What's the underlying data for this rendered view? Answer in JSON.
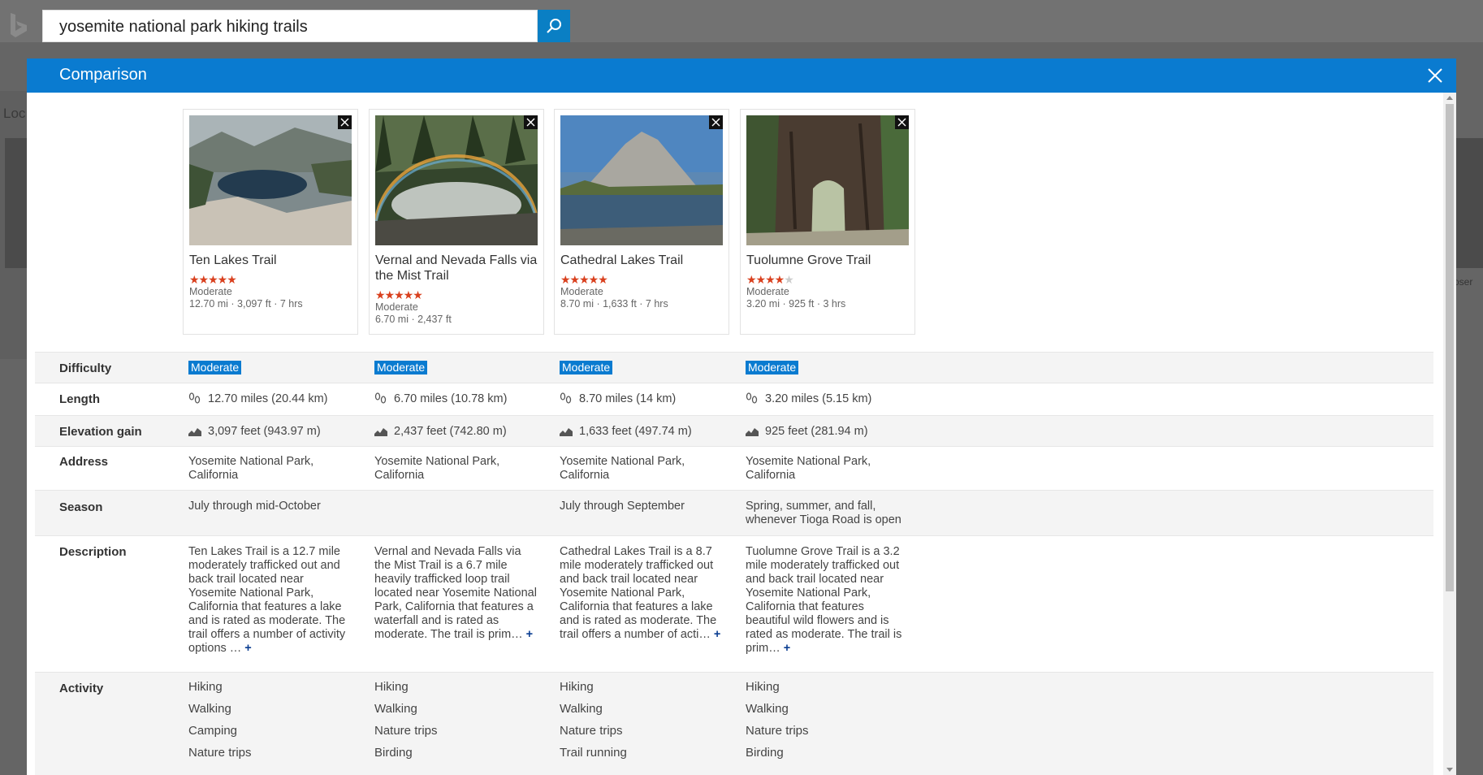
{
  "search": {
    "query": "yosemite national park hiking trails"
  },
  "background": {
    "left_text": "Loc",
    "right_text": "oser"
  },
  "modal": {
    "title": "Comparison"
  },
  "trails": [
    {
      "name": "Ten Lakes Trail",
      "rating": 4.5,
      "difficulty": "Moderate",
      "summary": "12.70 mi · 3,097 ft · 7 hrs",
      "length": "12.70 miles (20.44 km)",
      "elevation": "3,097 feet (943.97 m)",
      "address": "Yosemite National Park, California",
      "season": "July through mid-October",
      "description": "Ten Lakes Trail is a 12.7 mile moderately trafficked out and back trail located near Yosemite National Park, California that features a lake and is rated as moderate. The trail offers a number of activity options …",
      "activities": [
        "Hiking",
        "Walking",
        "Camping",
        "Nature trips"
      ]
    },
    {
      "name": "Vernal and Nevada Falls via the Mist Trail",
      "rating": 4.5,
      "difficulty": "Moderate",
      "summary": "6.70 mi · 2,437 ft",
      "length": "6.70 miles (10.78 km)",
      "elevation": "2,437 feet (742.80 m)",
      "address": "Yosemite National Park, California",
      "season": "",
      "description": "Vernal and Nevada Falls via the Mist Trail is a 6.7 mile heavily trafficked loop trail located near Yosemite National Park, California that features a waterfall and is rated as moderate. The trail is prim…",
      "activities": [
        "Hiking",
        "Walking",
        "Nature trips",
        "Birding"
      ]
    },
    {
      "name": "Cathedral Lakes Trail",
      "rating": 4.5,
      "difficulty": "Moderate",
      "summary": "8.70 mi · 1,633 ft · 7 hrs",
      "length": "8.70 miles (14 km)",
      "elevation": "1,633 feet (497.74 m)",
      "address": "Yosemite National Park, California",
      "season": "July through September",
      "description": "Cathedral Lakes Trail is a 8.7 mile moderately trafficked out and back trail located near Yosemite National Park, California that features a lake and is rated as moderate. The trail offers a number of acti…",
      "activities": [
        "Hiking",
        "Walking",
        "Nature trips",
        "Trail running"
      ]
    },
    {
      "name": "Tuolumne Grove Trail",
      "rating": 4,
      "difficulty": "Moderate",
      "summary": "3.20 mi · 925 ft · 3 hrs",
      "length": "3.20 miles (5.15 km)",
      "elevation": "925 feet (281.94 m)",
      "address": "Yosemite National Park, California",
      "season": "Spring, summer, and fall, whenever Tioga Road is open",
      "description": "Tuolumne Grove Trail is a 3.2 mile moderately trafficked out and back trail located near Yosemite National Park, California that features beautiful wild flowers and is rated as moderate. The trail is prim…",
      "activities": [
        "Hiking",
        "Walking",
        "Nature trips",
        "Birding"
      ]
    }
  ],
  "row_labels": {
    "difficulty": "Difficulty",
    "length": "Length",
    "elevation": "Elevation gain",
    "address": "Address",
    "season": "Season",
    "description": "Description",
    "activity": "Activity"
  },
  "more_glyph": "+",
  "colors": {
    "accent": "#0a7bd0",
    "search_button": "#0a7fc4",
    "star": "#d9401e"
  },
  "icons": {
    "search": "search-icon",
    "close": "close-icon",
    "length": "footprints-icon",
    "elevation": "elevation-icon"
  }
}
